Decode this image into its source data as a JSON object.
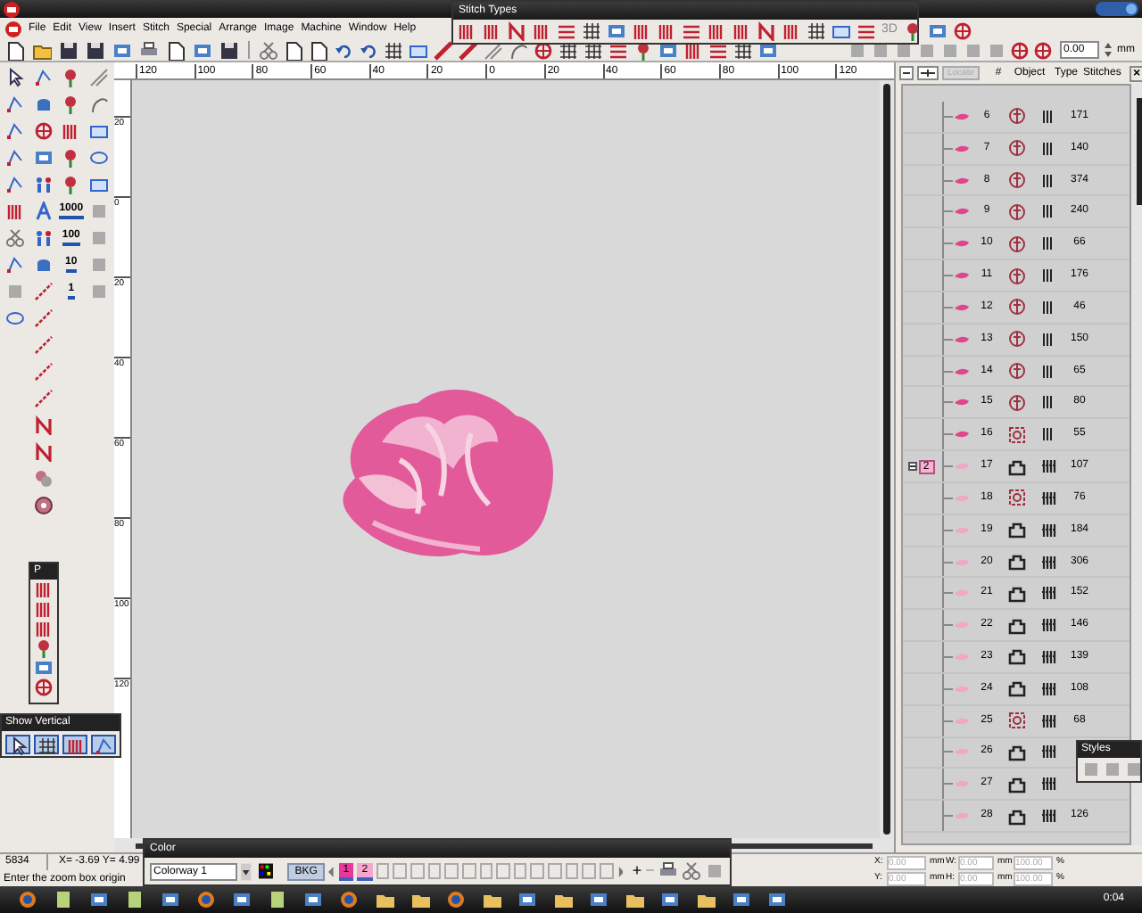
{
  "menu": [
    "File",
    "Edit",
    "View",
    "Insert",
    "Stitch",
    "Special",
    "Arrange",
    "Image",
    "Machine",
    "Window",
    "Help"
  ],
  "stitch_types": {
    "title": "Stitch Types",
    "label_3d": "3D"
  },
  "toolbar": {
    "offset_value": "0.00",
    "offset_unit": "mm"
  },
  "tool_palette": {
    "count_tools": [
      "1000",
      "100",
      "10",
      "1"
    ]
  },
  "top_ruler": [
    "120",
    "100",
    "80",
    "60",
    "40",
    "20",
    "0",
    "20",
    "40",
    "60",
    "80",
    "100",
    "120"
  ],
  "left_ruler": [
    "20",
    "0",
    "20",
    "40",
    "60",
    "80",
    "100",
    "120"
  ],
  "objects_panel": {
    "locate": "Locate",
    "columns": [
      "#",
      "Object",
      "Type",
      "Stitches"
    ],
    "close": "×"
  },
  "rows": [
    {
      "number": "6",
      "color": "#e0458f",
      "object": {
        "kind": "spiral"
      },
      "type": {
        "kind": "satin"
      },
      "stitches": "171"
    },
    {
      "number": "7",
      "color": "#e0458f",
      "object": {
        "kind": "spiral"
      },
      "type": {
        "kind": "satin"
      },
      "stitches": "140"
    },
    {
      "number": "8",
      "color": "#e0458f",
      "object": {
        "kind": "spiral"
      },
      "type": {
        "kind": "satin"
      },
      "stitches": "374"
    },
    {
      "number": "9",
      "color": "#e0458f",
      "object": {
        "kind": "spiral"
      },
      "type": {
        "kind": "satin"
      },
      "stitches": "240"
    },
    {
      "number": "10",
      "color": "#e0458f",
      "object": {
        "kind": "spiral"
      },
      "type": {
        "kind": "satin"
      },
      "stitches": "66"
    },
    {
      "number": "11",
      "color": "#e0458f",
      "object": {
        "kind": "spiral"
      },
      "type": {
        "kind": "satin"
      },
      "stitches": "176"
    },
    {
      "number": "12",
      "color": "#e0458f",
      "object": {
        "kind": "spiral"
      },
      "type": {
        "kind": "satin"
      },
      "stitches": "46"
    },
    {
      "number": "13",
      "color": "#e0458f",
      "object": {
        "kind": "spiral"
      },
      "type": {
        "kind": "satin"
      },
      "stitches": "150"
    },
    {
      "number": "14",
      "color": "#e0458f",
      "object": {
        "kind": "spiral"
      },
      "type": {
        "kind": "satin"
      },
      "stitches": "65"
    },
    {
      "number": "15",
      "color": "#e0458f",
      "object": {
        "kind": "spiral"
      },
      "type": {
        "kind": "satin"
      },
      "stitches": "80"
    },
    {
      "number": "16",
      "color": "#e0458f",
      "object": {
        "kind": "outline"
      },
      "type": {
        "kind": "satin"
      },
      "stitches": "55"
    },
    {
      "number": "17",
      "color": "#f2a6c8",
      "object": {
        "kind": "bag"
      },
      "type": {
        "kind": "fill"
      },
      "stitches": "107",
      "group_label": "2"
    },
    {
      "number": "18",
      "color": "#f2a6c8",
      "object": {
        "kind": "outline"
      },
      "type": {
        "kind": "fill"
      },
      "stitches": "76"
    },
    {
      "number": "19",
      "color": "#f2a6c8",
      "object": {
        "kind": "bag"
      },
      "type": {
        "kind": "fill"
      },
      "stitches": "184"
    },
    {
      "number": "20",
      "color": "#f2a6c8",
      "object": {
        "kind": "bag"
      },
      "type": {
        "kind": "fill"
      },
      "stitches": "306"
    },
    {
      "number": "21",
      "color": "#f2a6c8",
      "object": {
        "kind": "bag"
      },
      "type": {
        "kind": "fill"
      },
      "stitches": "152"
    },
    {
      "number": "22",
      "color": "#f2a6c8",
      "object": {
        "kind": "bag"
      },
      "type": {
        "kind": "fill"
      },
      "stitches": "146"
    },
    {
      "number": "23",
      "color": "#f2a6c8",
      "object": {
        "kind": "bag"
      },
      "type": {
        "kind": "fill"
      },
      "stitches": "139"
    },
    {
      "number": "24",
      "color": "#f2a6c8",
      "object": {
        "kind": "bag"
      },
      "type": {
        "kind": "fill"
      },
      "stitches": "108"
    },
    {
      "number": "25",
      "color": "#f2a6c8",
      "object": {
        "kind": "outline"
      },
      "type": {
        "kind": "fill"
      },
      "stitches": "68"
    },
    {
      "number": "26",
      "color": "#f2a6c8",
      "object": {
        "kind": "bag"
      },
      "type": {
        "kind": "fill"
      }
    },
    {
      "number": "27",
      "color": "#f2a6c8",
      "object": {
        "kind": "bag"
      },
      "type": {
        "kind": "fill"
      }
    },
    {
      "number": "28",
      "color": "#f2a6c8",
      "object": {
        "kind": "bag"
      },
      "type": {
        "kind": "fill"
      },
      "stitches": "126"
    }
  ],
  "show_vertical": {
    "title": "Show Vertical"
  },
  "mini_palette": {
    "title": "P"
  },
  "styles_panel": {
    "title": "Styles"
  },
  "status": {
    "stitch_count": "5834",
    "coordinates": "X= -3.69 Y= 4.99",
    "message": "Enter the zoom box origin"
  },
  "color_panel": {
    "title": "Color",
    "colorway": "Colorway 1",
    "background": "BKG",
    "swatches": [
      {
        "label": "1",
        "color": "#e8389a",
        "selected": true
      },
      {
        "label": "2",
        "color": "#f4a6cc",
        "selected": true
      }
    ],
    "add": "+",
    "remove": "−"
  },
  "transform": [
    {
      "axis": "X:",
      "value": "0.00",
      "unit": "mm",
      "size_label": "W:",
      "size": "0.00",
      "size_unit": "mm",
      "scale": "100.00",
      "scale_unit": "%"
    },
    {
      "axis": "Y:",
      "value": "0.00",
      "unit": "mm",
      "size_label": "H:",
      "size": "0.00",
      "size_unit": "mm",
      "scale": "100.00",
      "scale_unit": "%"
    }
  ],
  "clock": "0:04"
}
